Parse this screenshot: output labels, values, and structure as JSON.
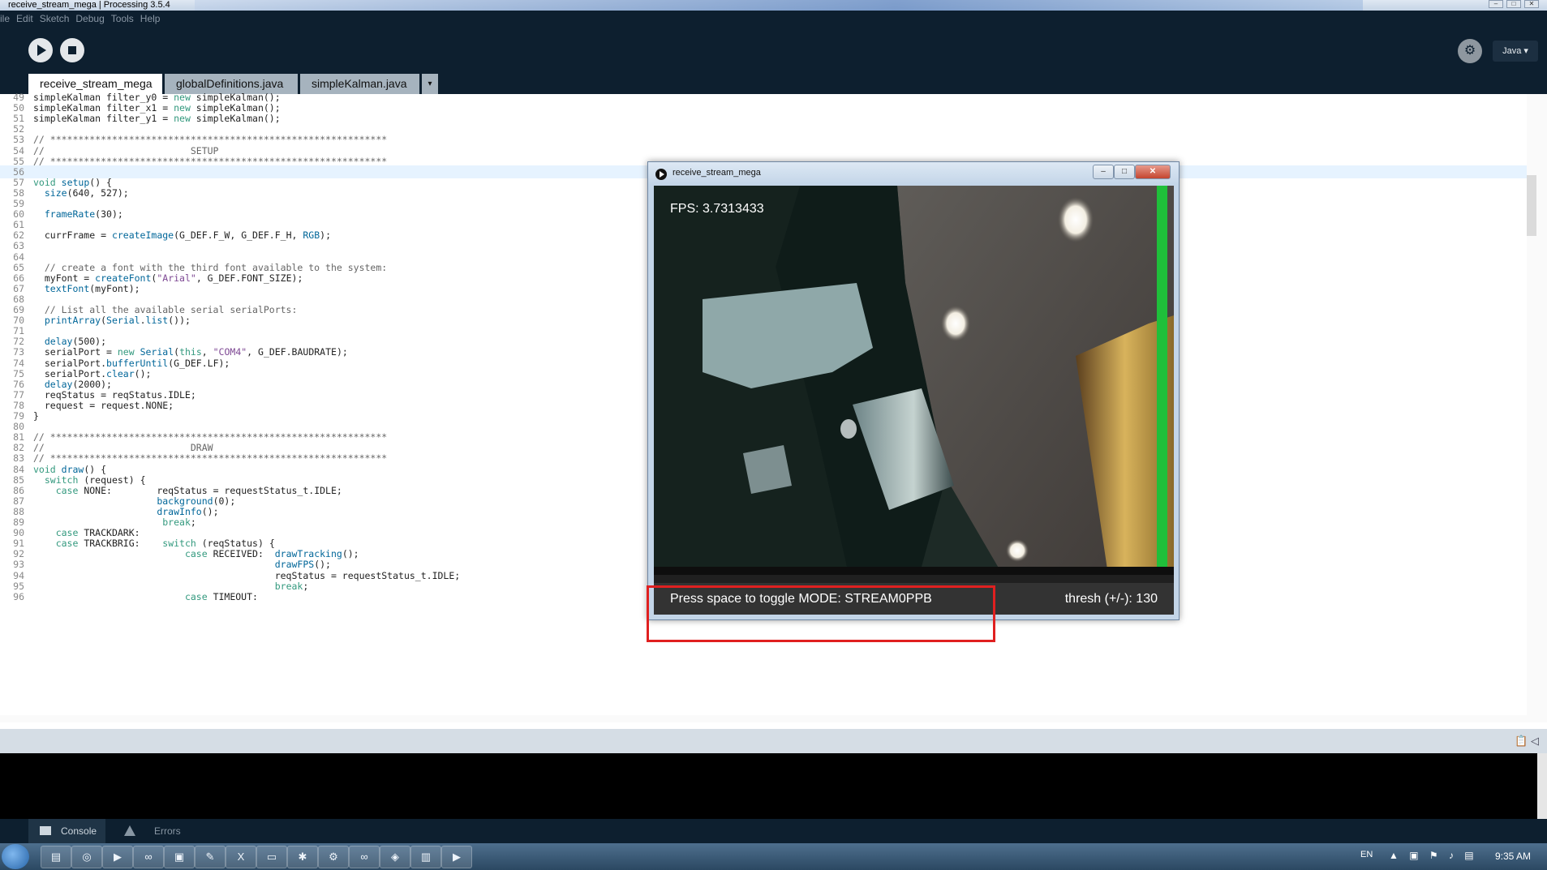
{
  "window": {
    "title": "receive_stream_mega | Processing 3.5.4",
    "controls": [
      "–",
      "□",
      "✕"
    ]
  },
  "menu": [
    "ile",
    "Edit",
    "Sketch",
    "Debug",
    "Tools",
    "Help"
  ],
  "toolbar": {
    "run_icon": "play-icon",
    "stop_icon": "stop-icon",
    "debug_icon": "debugger-icon",
    "mode_label": "Java ▾"
  },
  "tabs": [
    "receive_stream_mega",
    "globalDefinitions.java",
    "simpleKalman.java"
  ],
  "tab_overflow_label": "▾",
  "editor": {
    "current_line": 56,
    "lines": [
      {
        "n": "49",
        "code": "simpleKalman filter_y0 = new simpleKalman();"
      },
      {
        "n": "50",
        "code": "simpleKalman filter_x1 = new simpleKalman();"
      },
      {
        "n": "51",
        "code": "simpleKalman filter_y1 = new simpleKalman();"
      },
      {
        "n": "52",
        "code": ""
      },
      {
        "n": "53",
        "code": "// ************************************************************"
      },
      {
        "n": "54",
        "code": "//                          SETUP"
      },
      {
        "n": "55",
        "code": "// ************************************************************"
      },
      {
        "n": "56",
        "code": ""
      },
      {
        "n": "57",
        "code": "void setup() {"
      },
      {
        "n": "58",
        "code": "  size(640, 527);"
      },
      {
        "n": "59",
        "code": ""
      },
      {
        "n": "60",
        "code": "  frameRate(30);"
      },
      {
        "n": "61",
        "code": ""
      },
      {
        "n": "62",
        "code": "  currFrame = createImage(G_DEF.F_W, G_DEF.F_H, RGB);"
      },
      {
        "n": "63",
        "code": ""
      },
      {
        "n": "64",
        "code": ""
      },
      {
        "n": "65",
        "code": "  // create a font with the third font available to the system:"
      },
      {
        "n": "66",
        "code": "  myFont = createFont(\"Arial\", G_DEF.FONT_SIZE);"
      },
      {
        "n": "67",
        "code": "  textFont(myFont);"
      },
      {
        "n": "68",
        "code": ""
      },
      {
        "n": "69",
        "code": "  // List all the available serial serialPorts:"
      },
      {
        "n": "70",
        "code": "  printArray(Serial.list());"
      },
      {
        "n": "71",
        "code": ""
      },
      {
        "n": "72",
        "code": "  delay(500);"
      },
      {
        "n": "73",
        "code": "  serialPort = new Serial(this, \"COM4\", G_DEF.BAUDRATE);"
      },
      {
        "n": "74",
        "code": "  serialPort.bufferUntil(G_DEF.LF);"
      },
      {
        "n": "75",
        "code": "  serialPort.clear();"
      },
      {
        "n": "76",
        "code": "  delay(2000);"
      },
      {
        "n": "77",
        "code": "  reqStatus = reqStatus.IDLE;"
      },
      {
        "n": "78",
        "code": "  request = request.NONE;"
      },
      {
        "n": "79",
        "code": "}"
      },
      {
        "n": "80",
        "code": ""
      },
      {
        "n": "81",
        "code": "// ************************************************************"
      },
      {
        "n": "82",
        "code": "//                          DRAW"
      },
      {
        "n": "83",
        "code": "// ************************************************************"
      },
      {
        "n": "84",
        "code": "void draw() {"
      },
      {
        "n": "85",
        "code": "  switch (request) {"
      },
      {
        "n": "86",
        "code": "    case NONE:        reqStatus = requestStatus_t.IDLE;"
      },
      {
        "n": "87",
        "code": "                      background(0);"
      },
      {
        "n": "88",
        "code": "                      drawInfo();"
      },
      {
        "n": "89",
        "code": "                       break;"
      },
      {
        "n": "90",
        "code": "    case TRACKDARK:"
      },
      {
        "n": "91",
        "code": "    case TRACKBRIG:    switch (reqStatus) {"
      },
      {
        "n": "92",
        "code": "                           case RECEIVED:  drawTracking();"
      },
      {
        "n": "93",
        "code": "                                           drawFPS();"
      },
      {
        "n": "94",
        "code": "                                           reqStatus = requestStatus_t.IDLE;"
      },
      {
        "n": "95",
        "code": "                                           break;"
      },
      {
        "n": "96",
        "code": "                           case TIMEOUT:"
      }
    ]
  },
  "sketch_window": {
    "title": "receive_stream_mega",
    "fps_text": "FPS: 3.7313433",
    "mode_text": "Press space to toggle MODE: STREAM0PPB",
    "thresh_text": "thresh (+/-): 130"
  },
  "console_tabs": [
    "Console",
    "Errors"
  ],
  "taskbar": {
    "language": "EN",
    "clock": "9:35 AM",
    "apps": [
      "folder-icon",
      "browser-icon",
      "processing-icon",
      "arduino-icon",
      "terminal-icon",
      "editor-icon",
      "x-icon",
      "window-icon",
      "bug-icon",
      "settings-icon",
      "arduino-icon",
      "network-icon",
      "notes-icon",
      "play-icon"
    ]
  },
  "colors": {
    "ide_background": "#0d1f2f",
    "keyword": "#33997e",
    "function": "#006699",
    "comment": "#666666",
    "string": "#7d4793",
    "annotation": "#e02020"
  }
}
